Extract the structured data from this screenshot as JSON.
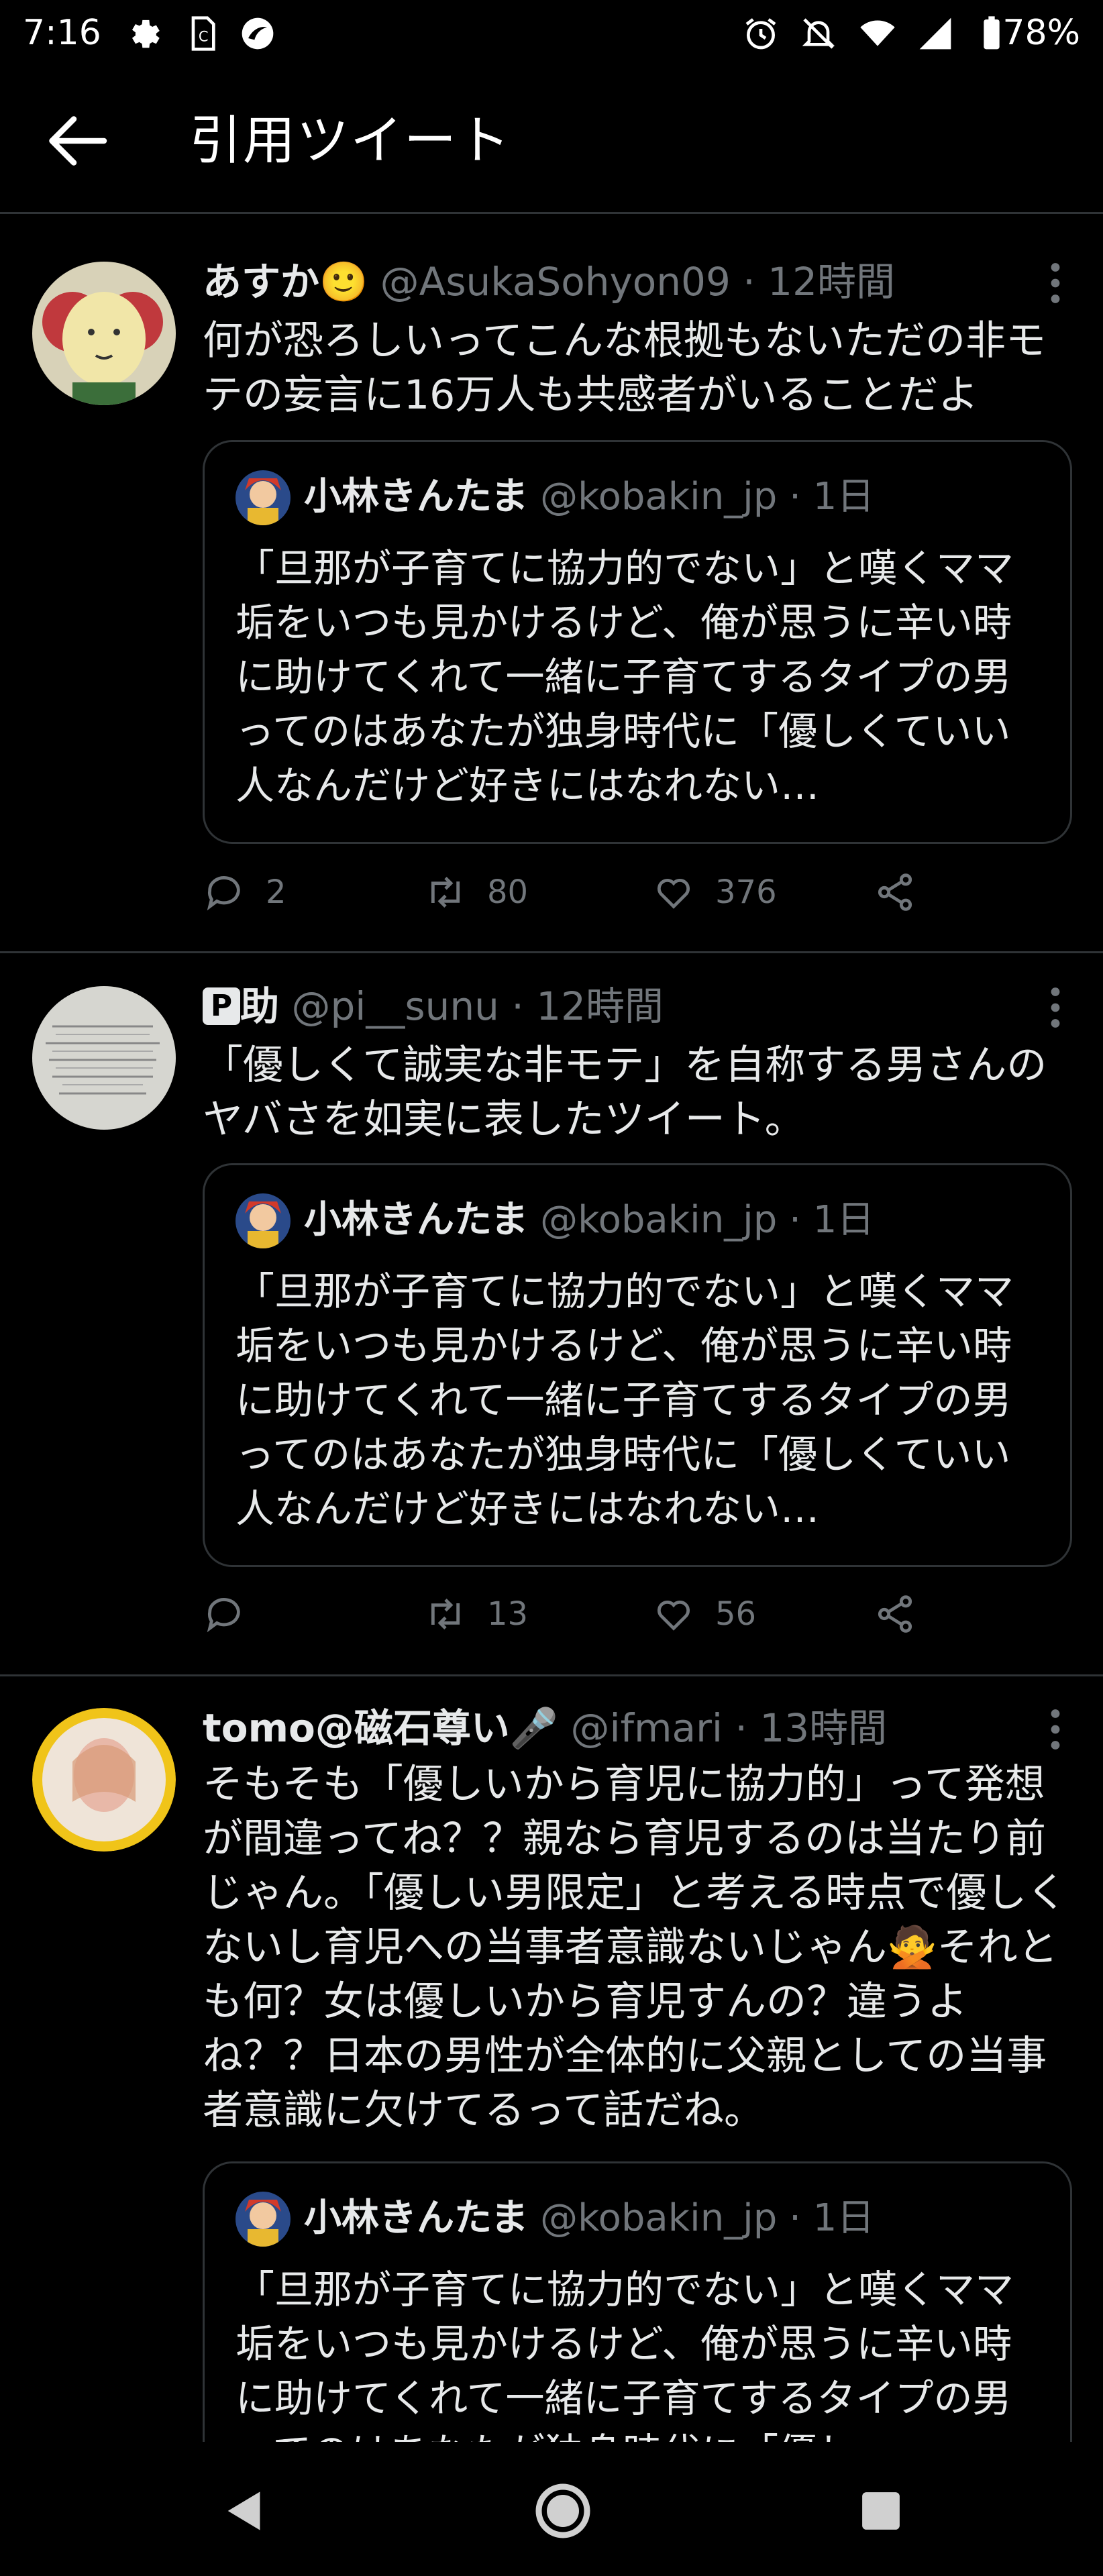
{
  "status_bar": {
    "time": "7:16",
    "battery": "78%",
    "icons": [
      "gear-icon",
      "sim-icon",
      "loop-icon",
      "alarm-icon",
      "mute-icon",
      "wifi-icon",
      "signal-icon",
      "battery-icon"
    ]
  },
  "header": {
    "title": "引用ツイート"
  },
  "tweets": [
    {
      "name": "あすか🙂",
      "handle": "@AsukaSohyon09",
      "sep": "·",
      "time": "12時間",
      "text": "何が恐ろしいってこんな根拠もないただの非モテの妄言に16万人も共感者がいることだよ",
      "quote": {
        "name": "小林きんたま",
        "handle": "@kobakin_jp",
        "sep": "·",
        "time": "1日",
        "text": "「旦那が子育てに協力的でない」と嘆くママ垢をいつも見かけるけど、俺が思うに辛い時に助けてくれて一緒に子育てするタイプの男ってのはあなたが独身時代に「優しくていい人なんだけど好きにはなれない…"
      },
      "replies": "2",
      "retweets": "80",
      "likes": "376"
    },
    {
      "name_badge": "P",
      "name": "助",
      "handle": "@pi__sunu",
      "sep": "·",
      "time": "12時間",
      "text": "「優しくて誠実な非モテ」を自称する男さんのヤバさを如実に表したツイート。",
      "quote": {
        "name": "小林きんたま",
        "handle": "@kobakin_jp",
        "sep": "·",
        "time": "1日",
        "text": "「旦那が子育てに協力的でない」と嘆くママ垢をいつも見かけるけど、俺が思うに辛い時に助けてくれて一緒に子育てするタイプの男ってのはあなたが独身時代に「優しくていい人なんだけど好きにはなれない…"
      },
      "replies": "",
      "retweets": "13",
      "likes": "56"
    },
    {
      "name": "tomo@磁石尊い🎤",
      "handle": "@ifmari",
      "sep": "·",
      "time": "13時間",
      "text": "そもそも「優しいから育児に協力的」って発想が間違ってね？？親なら育児するのは当たり前じゃん。「優しい男限定」と考える時点で優しくないし育児への当事者意識ないじゃん🙅それとも何？女は優しいから育児すんの？違うよね？？日本の男性が全体的に父親としての当事者意識に欠けてるって話だね。",
      "quote": {
        "name": "小林きんたま",
        "handle": "@kobakin_jp",
        "sep": "·",
        "time": "1日",
        "text": "「旦那が子育てに協力的でない」と嘆くママ垢をいつも見かけるけど、俺が思うに辛い時に助けてくれて一緒に子育てするタイプの男ってのはあなたが独身時代に「優し"
      }
    }
  ],
  "colors": {
    "background": "#000000",
    "text": "#e7e9ea",
    "muted": "#71767b",
    "divider": "#2f3336"
  }
}
